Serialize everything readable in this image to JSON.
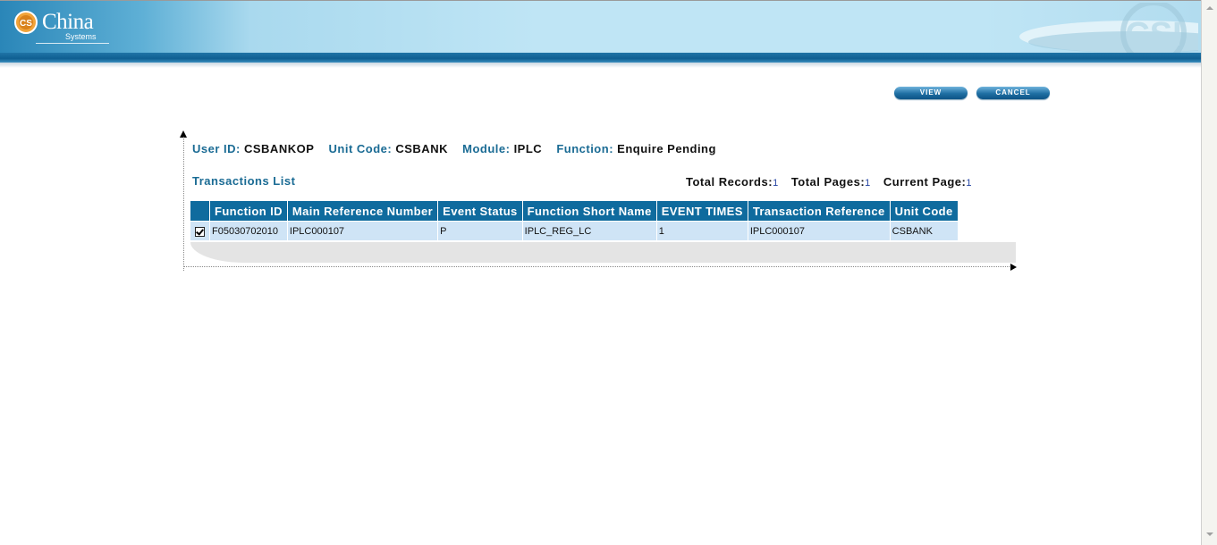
{
  "header": {
    "logo_badge": "CS",
    "logo_title": "China",
    "logo_subtitle": "Systems",
    "deco_mark": "CSI"
  },
  "actions": {
    "view_label": "VIEW",
    "cancel_label": "CANCEL"
  },
  "info": {
    "user_id_label": "User ID:",
    "user_id": "CSBANKOP",
    "unit_code_label": "Unit Code:",
    "unit_code": "CSBANK",
    "module_label": "Module:",
    "module": "IPLC",
    "function_label": "Function:",
    "function": "Enquire Pending"
  },
  "list": {
    "title": "Transactions List",
    "total_records_label": "Total Records:",
    "total_records": "1",
    "total_pages_label": "Total Pages:",
    "total_pages": "1",
    "current_page_label": "Current Page:",
    "current_page": "1",
    "columns": [
      "Function ID",
      "Main Reference Number",
      "Event Status",
      "Function Short Name",
      "EVENT TIMES",
      "Transaction Reference",
      "Unit Code"
    ],
    "rows": [
      {
        "selected": true,
        "cells": [
          "F05030702010",
          "IPLC000107",
          "P",
          "IPLC_REG_LC",
          "1",
          "IPLC000107",
          "CSBANK"
        ]
      }
    ]
  },
  "colors": {
    "accent": "#0f6b9e",
    "label_text": "#1a6b94",
    "row_bg": "#cfe4f6"
  }
}
